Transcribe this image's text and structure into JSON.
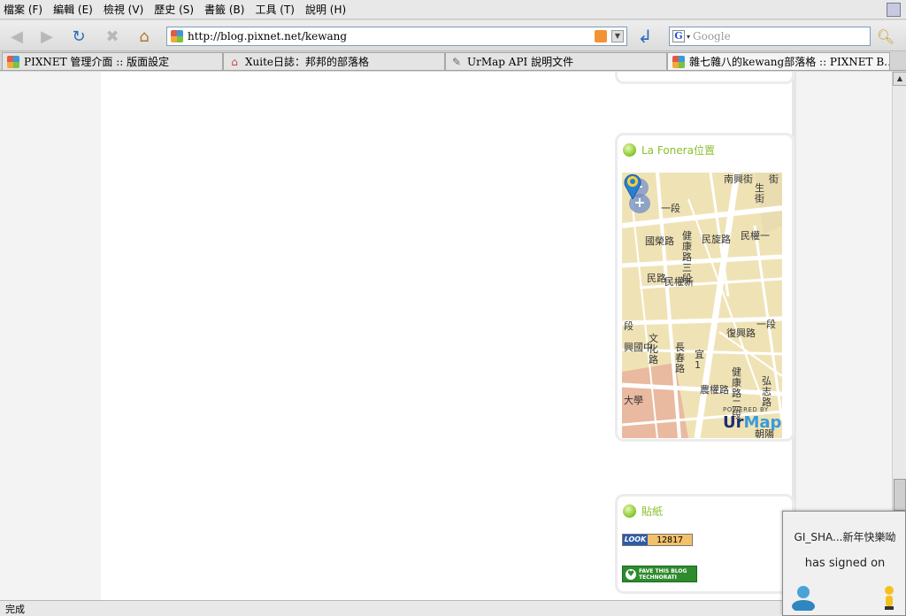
{
  "menu": {
    "items": [
      "檔案 (F)",
      "編輯 (E)",
      "檢視 (V)",
      "歷史 (S)",
      "書籤 (B)",
      "工具 (T)",
      "說明 (H)"
    ]
  },
  "navbar": {
    "url": "http://blog.pixnet.net/kewang",
    "search_placeholder": "Google"
  },
  "tabs": [
    {
      "label": "PIXNET 管理介面 :: 版面設定",
      "icon": "pixnet-favicon",
      "active": false
    },
    {
      "label": "Xuite日誌：邦邦的部落格",
      "icon": "home-icon",
      "active": false
    },
    {
      "label": "UrMap API 說明文件",
      "icon": "link-icon",
      "active": false
    },
    {
      "label": "雜七雜八的kewang部落格 :: PIXNET B…",
      "icon": "pixnet-favicon",
      "active": true
    }
  ],
  "widgets": {
    "map": {
      "title": "La Fonera位置",
      "powered": "POWERED BY",
      "brand_main": "Ur",
      "brand_accent": "Map",
      "labels": {
        "top": "南興街",
        "sheng": "生街",
        "road_top": "街",
        "yiduan_top": "一段",
        "guorong": "國榮路",
        "jiankang": "健康路三段",
        "minxuan": "民旋路",
        "minquan": "民權一",
        "minquan_road": "民權新",
        "shang_min": "民路",
        "wenhua": "文化路",
        "changchun": "長春路",
        "fuxing": "復興路",
        "yiduan_mid": "一段",
        "yi_road": "宜1",
        "guoguo": "興國中",
        "duan_left": "段",
        "jiankang2": "健康路二段",
        "nongquan": "農權路",
        "hongzhi": "弘志路",
        "daxue": "大學",
        "zhaoyang": "朝陽"
      }
    },
    "sticker": {
      "title": "貼紙",
      "look_logo": "LOOK",
      "look_count": "12817",
      "techno_line1": "FAVE THIS BLOG",
      "techno_line2": "TECHNORATI"
    }
  },
  "status": {
    "text": "完成"
  },
  "notification": {
    "line1": "GI_SHA...新年快樂呦",
    "line2": "has signed on"
  }
}
